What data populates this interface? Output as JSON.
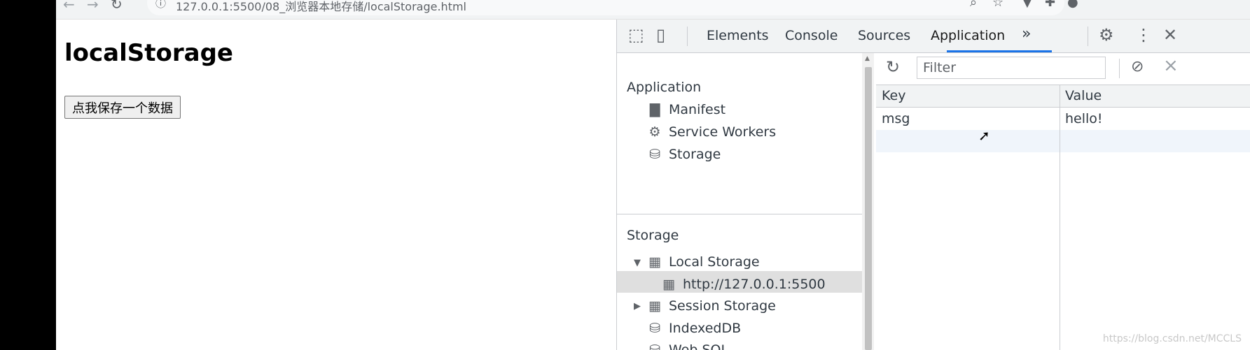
{
  "browser": {
    "url": "127.0.0.1:5500/08_浏览器本地存储/localStorage.html"
  },
  "page": {
    "heading": "localStorage",
    "button_label": "点我保存一个数据"
  },
  "devtools": {
    "tabs": [
      {
        "label": "Elements",
        "active": false
      },
      {
        "label": "Console",
        "active": false
      },
      {
        "label": "Sources",
        "active": false
      },
      {
        "label": "Application",
        "active": true
      }
    ],
    "more_tabs": "»",
    "sidebar": {
      "application_section": {
        "title": "Application",
        "items": [
          {
            "label": "Manifest",
            "icon": "file-icon"
          },
          {
            "label": "Service Workers",
            "icon": "gear-icon"
          },
          {
            "label": "Storage",
            "icon": "database-icon"
          }
        ]
      },
      "storage_section": {
        "title": "Storage",
        "local_storage": {
          "label": "Local Storage",
          "expanded": true,
          "child": "http://127.0.0.1:5500"
        },
        "session_storage": {
          "label": "Session Storage",
          "expanded": false
        },
        "indexeddb": {
          "label": "IndexedDB"
        },
        "websql": {
          "label": "Web SQL"
        }
      }
    },
    "storage_pane": {
      "filter_placeholder": "Filter",
      "columns": [
        "Key",
        "Value"
      ],
      "rows": [
        {
          "key": "msg",
          "value": "hello!"
        }
      ]
    }
  },
  "watermark": "https://blog.csdn.net/MCCLS"
}
